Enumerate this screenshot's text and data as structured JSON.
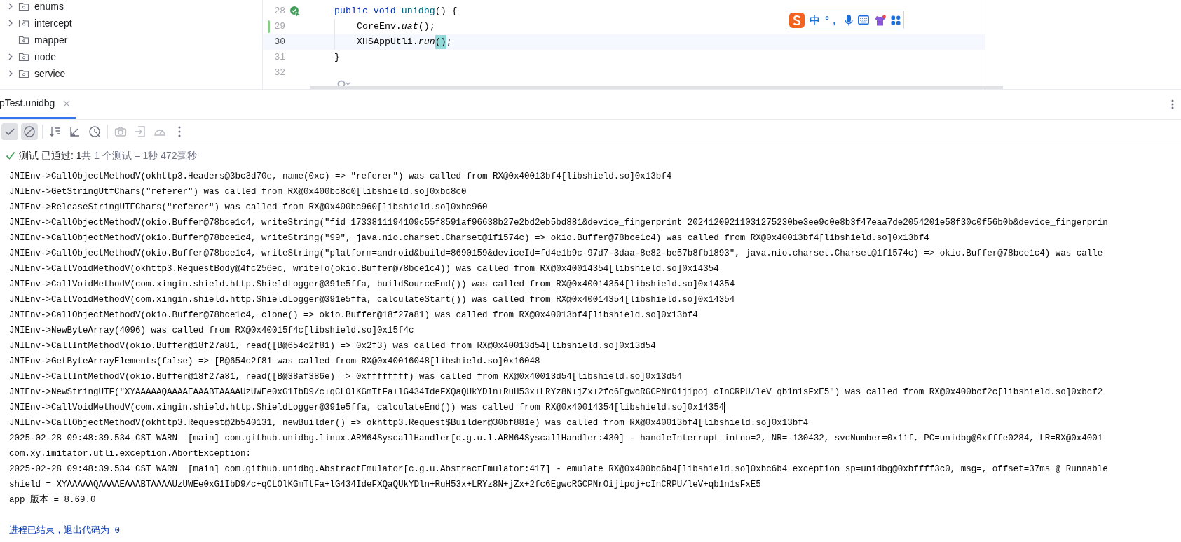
{
  "project_tree": {
    "items": [
      {
        "label": "enums",
        "expandable": true
      },
      {
        "label": "intercept",
        "expandable": true
      },
      {
        "label": "mapper",
        "expandable": false
      },
      {
        "label": "node",
        "expandable": true
      },
      {
        "label": "service",
        "expandable": true
      }
    ]
  },
  "editor": {
    "lines": [
      {
        "number": "28",
        "run_marker": true,
        "changed": false,
        "current": false,
        "indent": false,
        "tokens": [
          {
            "text": "public void ",
            "kind": "keyword"
          },
          {
            "text": "unidbg",
            "kind": "method"
          },
          {
            "text": "() {",
            "kind": "plain"
          }
        ]
      },
      {
        "number": "29",
        "run_marker": false,
        "changed": true,
        "current": false,
        "indent": true,
        "tokens": [
          {
            "text": "CoreEnv.",
            "kind": "plain"
          },
          {
            "text": "uat",
            "kind": "italic"
          },
          {
            "text": "();",
            "kind": "plain"
          }
        ]
      },
      {
        "number": "30",
        "run_marker": false,
        "changed": false,
        "current": true,
        "indent": true,
        "tokens": [
          {
            "text": "XHSAppUtli.",
            "kind": "plain"
          },
          {
            "text": "run",
            "kind": "italic"
          },
          {
            "text": "()",
            "kind": "match"
          },
          {
            "text": ";",
            "kind": "plain"
          }
        ]
      },
      {
        "number": "31",
        "run_marker": false,
        "changed": false,
        "current": false,
        "indent": false,
        "tokens": [
          {
            "text": "}",
            "kind": "plain"
          }
        ]
      },
      {
        "number": "32",
        "run_marker": false,
        "changed": false,
        "current": false,
        "indent": false
      }
    ]
  },
  "ime_toolbar": {
    "chars": [
      "中",
      "°，"
    ]
  },
  "run_panel": {
    "tabs": [
      {
        "label": "pTest.unidbg",
        "selected": true
      }
    ],
    "toolbar": [
      {
        "kind": "check",
        "selected": true,
        "disabled": false
      },
      {
        "kind": "stop",
        "selected": true,
        "disabled": false
      },
      {
        "kind": "separator"
      },
      {
        "kind": "sort",
        "selected": false,
        "disabled": false
      },
      {
        "kind": "collapse",
        "selected": false,
        "disabled": false
      },
      {
        "kind": "history",
        "selected": false,
        "disabled": false
      },
      {
        "kind": "separator"
      },
      {
        "kind": "camera",
        "selected": false,
        "disabled": true
      },
      {
        "kind": "import",
        "selected": false,
        "disabled": true
      },
      {
        "kind": "gauge",
        "selected": false,
        "disabled": true
      },
      {
        "kind": "more",
        "selected": false,
        "disabled": false
      }
    ],
    "status": {
      "passed": true,
      "label": "测试 已通过: 1",
      "detail": "共 1 个测试 – 1秒 472毫秒"
    },
    "console": [
      {
        "kind": "log",
        "caret": false,
        "text": "JNIEnv->CallObjectMethodV(okhttp3.Headers@3bc3d70e, name(0xc) => \"referer\") was called from RX@0x40013bf4[libshield.so]0x13bf4"
      },
      {
        "kind": "log",
        "caret": false,
        "text": "JNIEnv->GetStringUtfChars(\"referer\") was called from RX@0x400bc8c0[libshield.so]0xbc8c0"
      },
      {
        "kind": "log",
        "caret": false,
        "text": "JNIEnv->ReleaseStringUTFChars(\"referer\") was called from RX@0x400bc960[libshield.so]0xbc960"
      },
      {
        "kind": "log",
        "caret": false,
        "text": "JNIEnv->CallObjectMethodV(okio.Buffer@78bce1c4, writeString(\"fid=1733811194109c55f8591af96638b27e2bd2eb5bd881&device_fingerprint=20241209211031275230be3ee9c0e8b3f47eaa7de2054201e58f30c0f56b0b&device_fingerprin"
      },
      {
        "kind": "log",
        "caret": false,
        "text": "JNIEnv->CallObjectMethodV(okio.Buffer@78bce1c4, writeString(\"99\", java.nio.charset.Charset@1f1574c) => okio.Buffer@78bce1c4) was called from RX@0x40013bf4[libshield.so]0x13bf4"
      },
      {
        "kind": "log",
        "caret": false,
        "text": "JNIEnv->CallObjectMethodV(okio.Buffer@78bce1c4, writeString(\"platform=android&build=8690159&deviceId=fd4e1b9c-97d7-3daa-8e82-be57b8fb1893\", java.nio.charset.Charset@1f1574c) => okio.Buffer@78bce1c4) was calle"
      },
      {
        "kind": "log",
        "caret": false,
        "text": "JNIEnv->CallVoidMethodV(okhttp3.RequestBody@4fc256ec, writeTo(okio.Buffer@78bce1c4)) was called from RX@0x40014354[libshield.so]0x14354"
      },
      {
        "kind": "log",
        "caret": false,
        "text": "JNIEnv->CallVoidMethodV(com.xingin.shield.http.ShieldLogger@391e5ffa, buildSourceEnd()) was called from RX@0x40014354[libshield.so]0x14354"
      },
      {
        "kind": "log",
        "caret": false,
        "text": "JNIEnv->CallVoidMethodV(com.xingin.shield.http.ShieldLogger@391e5ffa, calculateStart()) was called from RX@0x40014354[libshield.so]0x14354"
      },
      {
        "kind": "log",
        "caret": false,
        "text": "JNIEnv->CallObjectMethodV(okio.Buffer@78bce1c4, clone() => okio.Buffer@18f27a81) was called from RX@0x40013bf4[libshield.so]0x13bf4"
      },
      {
        "kind": "log",
        "caret": false,
        "text": "JNIEnv->NewByteArray(4096) was called from RX@0x40015f4c[libshield.so]0x15f4c"
      },
      {
        "kind": "log",
        "caret": false,
        "text": "JNIEnv->CallIntMethodV(okio.Buffer@18f27a81, read([B@654c2f81) => 0x2f3) was called from RX@0x40013d54[libshield.so]0x13d54"
      },
      {
        "kind": "log",
        "caret": false,
        "text": "JNIEnv->GetByteArrayElements(false) => [B@654c2f81 was called from RX@0x40016048[libshield.so]0x16048"
      },
      {
        "kind": "log",
        "caret": false,
        "text": "JNIEnv->CallIntMethodV(okio.Buffer@18f27a81, read([B@38af386e) => 0xffffffff) was called from RX@0x40013d54[libshield.so]0x13d54"
      },
      {
        "kind": "log",
        "caret": false,
        "text": "JNIEnv->NewStringUTF(\"XYAAAAAQAAAAEAAABTAAAAUzUWEe0xG1IbD9/c+qCLOlKGmTtFa+lG434IdeFXQaQUkYDln+RuH53x+LRYz8N+jZx+2fc6EgwcRGCPNrOijipoj+cInCRPU/leV+qb1n1sFxE5\") was called from RX@0x400bcf2c[libshield.so]0xbcf2"
      },
      {
        "kind": "log",
        "caret": true,
        "text": "JNIEnv->CallVoidMethodV(com.xingin.shield.http.ShieldLogger@391e5ffa, calculateEnd()) was called from RX@0x40014354[libshield.so]0x14354"
      },
      {
        "kind": "log",
        "caret": false,
        "text": "JNIEnv->CallObjectMethodV(okhttp3.Request@2b540131, newBuilder() => okhttp3.Request$Builder@30bf881e) was called from RX@0x40013bf4[libshield.so]0x13bf4"
      },
      {
        "kind": "log",
        "caret": false,
        "text": "2025-02-28 09:48:39.534 CST WARN  [main] com.github.unidbg.linux.ARM64SyscallHandler[c.g.u.l.ARM64SyscallHandler:430] - handleInterrupt intno=2, NR=-130432, svcNumber=0x11f, PC=unidbg@0xfffe0284, LR=RX@0x4001"
      },
      {
        "kind": "log",
        "caret": false,
        "text": "com.xy.imitator.utli.exception.AbortException:"
      },
      {
        "kind": "log",
        "caret": false,
        "text": "2025-02-28 09:48:39.534 CST WARN  [main] com.github.unidbg.AbstractEmulator[c.g.u.AbstractEmulator:417] - emulate RX@0x400bc6b4[libshield.so]0xbc6b4 exception sp=unidbg@0xbffff3c0, msg=, offset=37ms @ Runnable"
      },
      {
        "kind": "log",
        "caret": false,
        "text": "shield = XYAAAAAQAAAAEAAABTAAAAUzUWEe0xG1IbD9/c+qCLOlKGmTtFa+lG434IdeFXQaQUkYDln+RuH53x+LRYz8N+jZx+2fc6EgwcRGCPNrOijipoj+cInCRPU/leV+qb1n1sFxE5"
      },
      {
        "kind": "log",
        "caret": false,
        "text": "app 版本 = 8.69.0"
      },
      {
        "kind": "exit",
        "caret": false,
        "text": "进程已结束，退出代码为 0"
      }
    ]
  }
}
